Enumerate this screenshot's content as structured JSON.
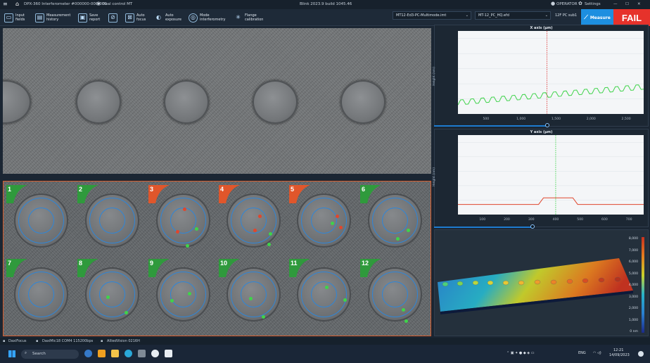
{
  "titlebar": {
    "app": "DPX-360 Interferometer #000000-000-000",
    "mode": "Dual control MT",
    "build": "Blink 2023.9 build 1045.46",
    "user": "OPERATOR",
    "settings": "Settings"
  },
  "toolbar": {
    "input_fields": "Input\nfields",
    "measurement_history": "Measurement\nhistory",
    "save_report": "Save\nreport",
    "auto_focus": "Auto\nfocus",
    "auto_exposure": "Auto\nexposure",
    "mode_interferometry": "Mode\ninterferometry",
    "flange_calibration": "Flange\ncalibration",
    "recipe_file": "MT12-Ed3-PC-Multimode.imt",
    "limits_file": "MT-12_PC_HQ.efd",
    "fiber_label": "12F PC sub1",
    "measure": "Measure",
    "result": "FAIL"
  },
  "colors": {
    "accent": "#1d8fe0",
    "fail": "#e6322b",
    "pass_badge": "#2f9a3c",
    "fail_badge": "#e0562b",
    "x_profile": "#3fd34a",
    "y_profile": "#e0462d",
    "x_cursor": "#e04040",
    "y_cursor": "#3fd34a"
  },
  "fibers": [
    {
      "n": "1",
      "status": "pass"
    },
    {
      "n": "2",
      "status": "pass"
    },
    {
      "n": "3",
      "status": "fail"
    },
    {
      "n": "4",
      "status": "fail"
    },
    {
      "n": "5",
      "status": "fail"
    },
    {
      "n": "6",
      "status": "pass"
    },
    {
      "n": "7",
      "status": "pass"
    },
    {
      "n": "8",
      "status": "pass"
    },
    {
      "n": "9",
      "status": "pass"
    },
    {
      "n": "10",
      "status": "pass"
    },
    {
      "n": "11",
      "status": "pass"
    },
    {
      "n": "12",
      "status": "pass"
    }
  ],
  "chart_data": [
    {
      "type": "line",
      "title": "X axis (µm)",
      "ylabel": "Height (nm)",
      "ylim": [
        0,
        27500
      ],
      "yticks": [
        "25,000",
        "20,000",
        "15,000",
        "10,000",
        "5,000"
      ],
      "xticks": [
        "500",
        "1,000",
        "1,500",
        "2,000",
        "2,500"
      ],
      "xlim": [
        100,
        2750
      ],
      "cursor_x": 1370,
      "series": [
        {
          "x": [
            100,
            2750
          ],
          "y": [
            3000,
            8200
          ]
        }
      ]
    },
    {
      "type": "line",
      "title": "Y axis (µm)",
      "ylabel": "Height (nm)",
      "ylim": [
        0,
        27500
      ],
      "yticks": [
        "25,000",
        "20,000",
        "15,000",
        "10,000",
        "5,000"
      ],
      "xticks": [
        "100",
        "200",
        "300",
        "400",
        "500",
        "600",
        "700"
      ],
      "xlim": [
        0,
        760
      ],
      "cursor_x": 400,
      "series": [
        {
          "x": [
            0,
            330,
            350,
            470,
            490,
            760
          ],
          "y": [
            3500,
            3500,
            5800,
            5800,
            3500,
            3500
          ]
        }
      ]
    },
    {
      "type": "heatmap",
      "title": "",
      "colorbar_ticks": [
        "8,000",
        "7,000",
        "6,000",
        "5,000",
        "4,000",
        "3,000",
        "2,000",
        "1,000",
        "0 nm"
      ]
    }
  ],
  "statusbar": {
    "focus": "DaxiFocus",
    "motor": "DaxiMic18 COM4 115200bps",
    "camera": "AlliedVision 0216H"
  },
  "taskbar": {
    "search": "Search",
    "lang": "ENG",
    "time": "12:21",
    "date": "14/09/2023"
  }
}
